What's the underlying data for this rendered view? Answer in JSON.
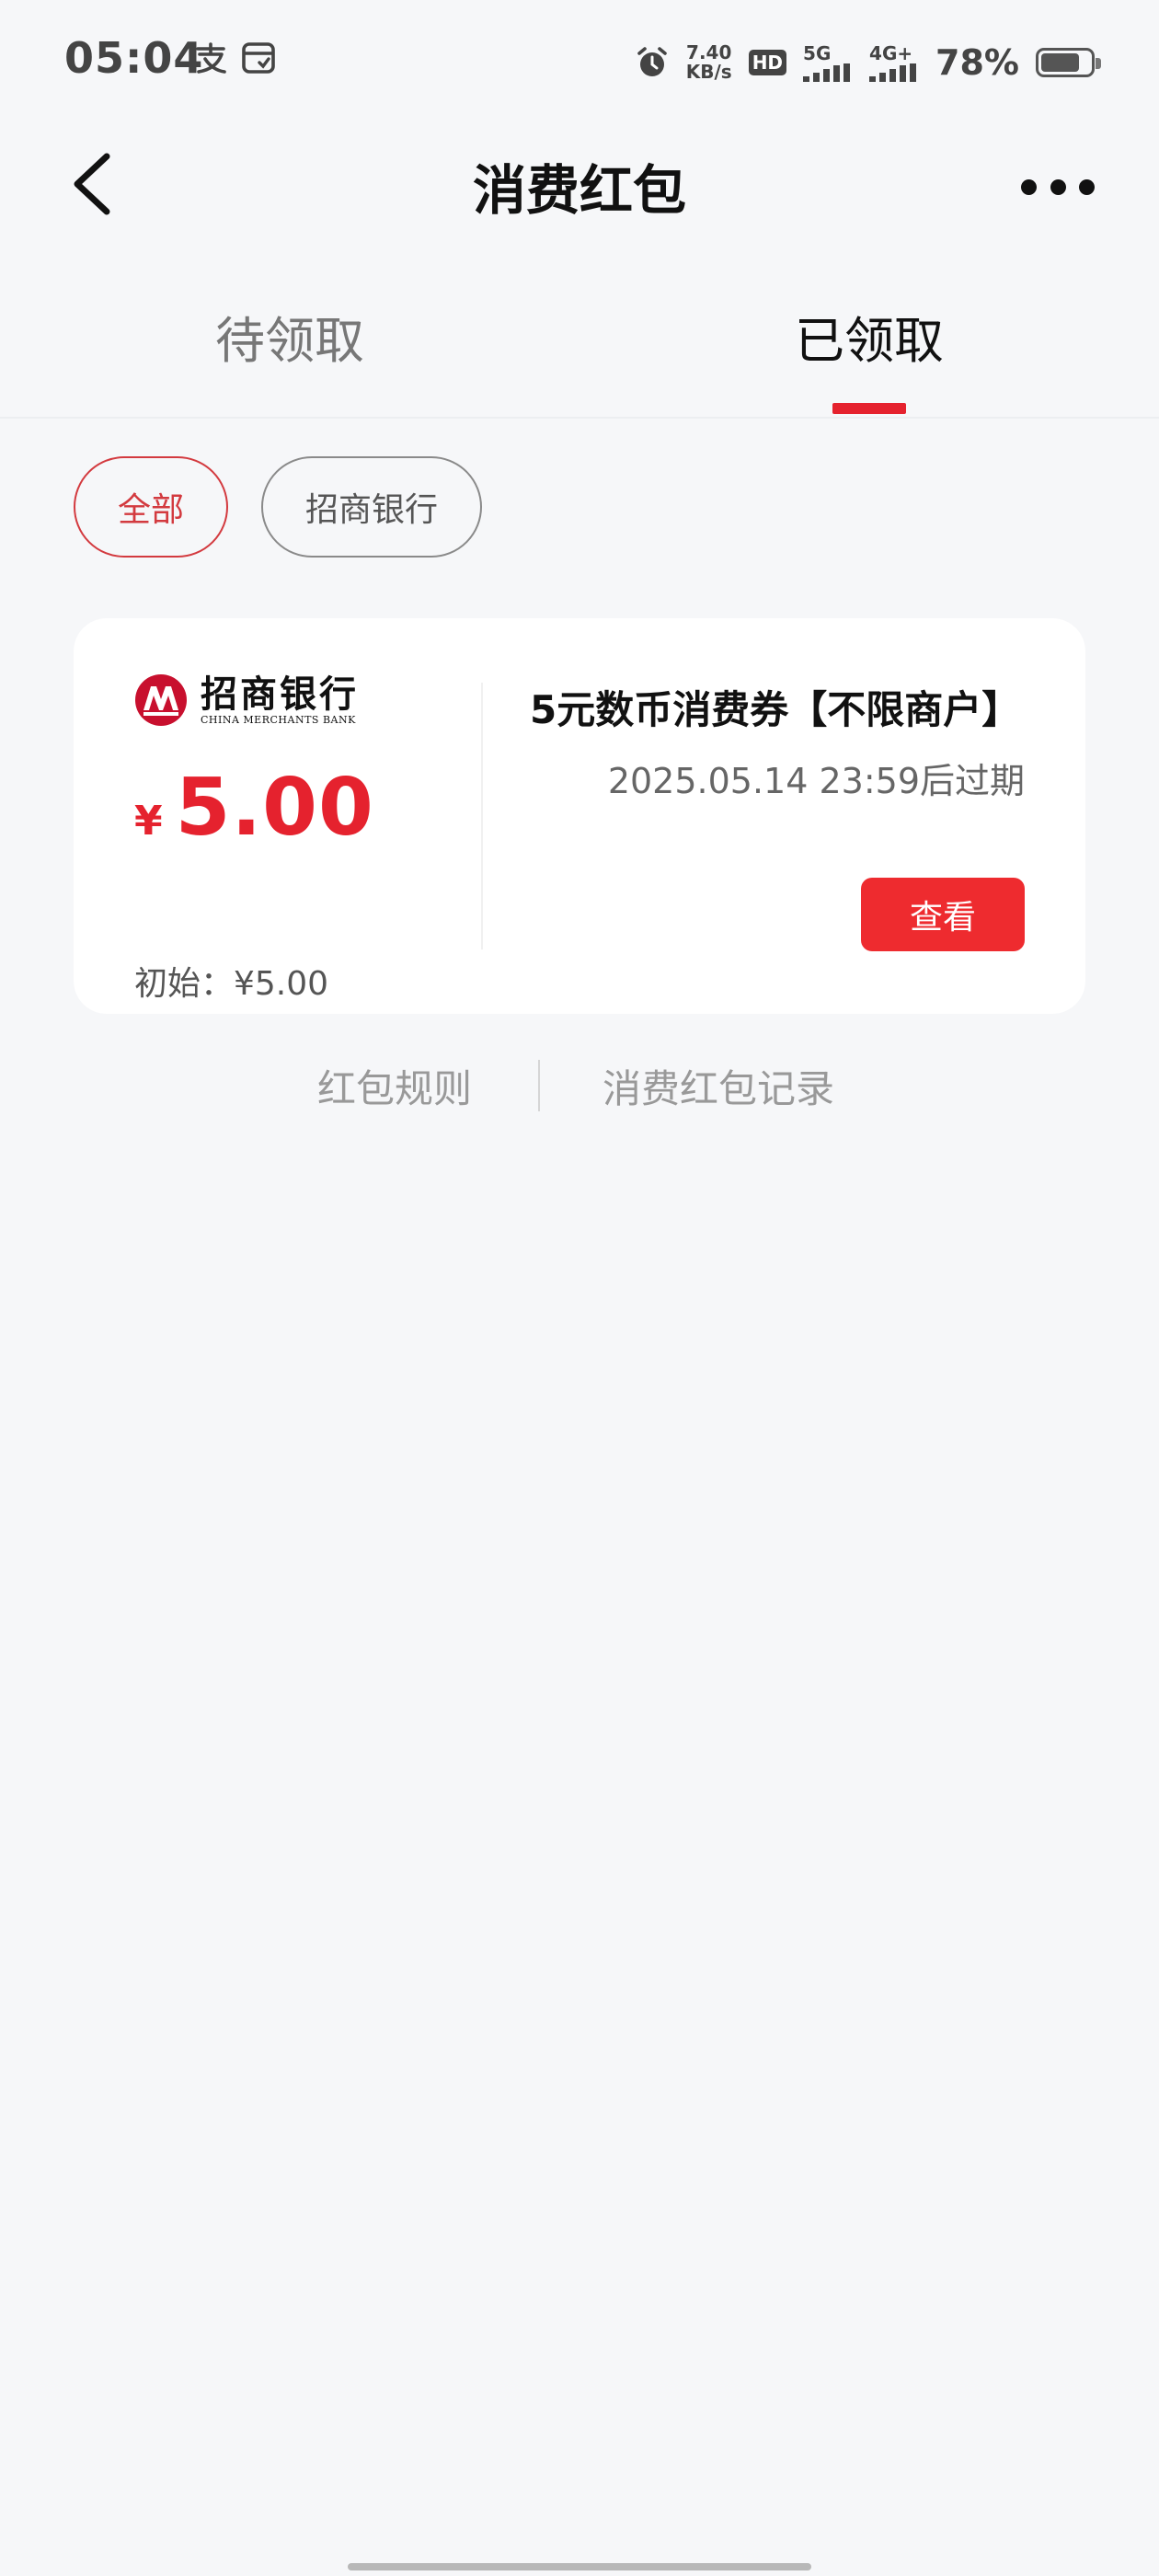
{
  "status_bar": {
    "time": "05:04",
    "net_speed_value": "7.40",
    "net_speed_unit": "KB/s",
    "hd_label": "HD",
    "sim1_label": "5G",
    "sim2_label": "4G+",
    "battery_text": "78%",
    "battery_level": 0.78
  },
  "nav": {
    "title": "消费红包"
  },
  "tabs": [
    {
      "label": "待领取",
      "selected": false
    },
    {
      "label": "已领取",
      "selected": true
    }
  ],
  "filters": [
    {
      "label": "全部",
      "selected": true
    },
    {
      "label": "招商银行",
      "selected": false
    }
  ],
  "coupon": {
    "bank_name_cn": "招商银行",
    "bank_name_en": "CHINA MERCHANTS BANK",
    "currency_symbol": "¥",
    "amount": "5.00",
    "initial_label": "初始：¥5.00",
    "title": "5元数币消费券【不限商户】",
    "expiry": "2025.05.14 23:59后过期",
    "view_button": "查看"
  },
  "footer_links": {
    "rules": "红包规则",
    "records": "消费红包记录"
  },
  "colors": {
    "accent": "#e5222e",
    "button": "#ee2b2f",
    "background": "#f6f7f9"
  }
}
